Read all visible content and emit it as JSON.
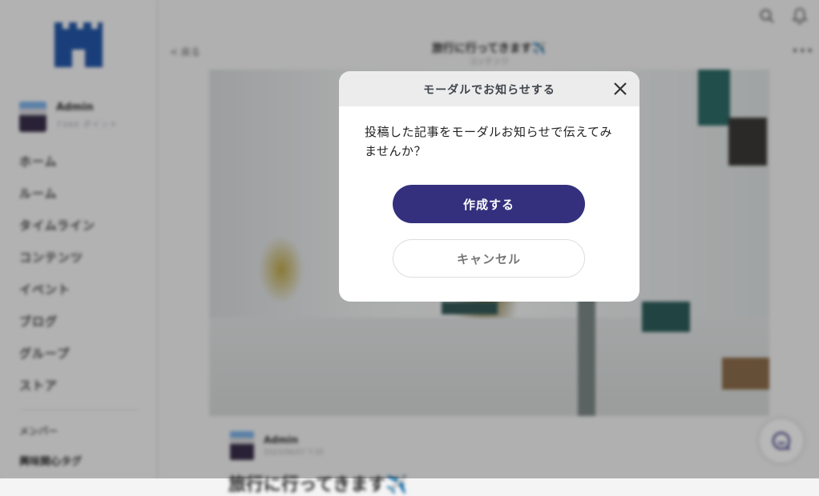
{
  "sidebar": {
    "profile": {
      "name": "Admin",
      "points": "7360 ポイント"
    },
    "nav": [
      "ホーム",
      "ルーム",
      "タイムライン",
      "コンテンツ",
      "イベント",
      "ブログ",
      "グループ",
      "ストア"
    ],
    "section_title": "メンバー",
    "tag_item": "興味関心タグ"
  },
  "header": {
    "back_label": "< 戻る",
    "title": "旅行に行ってきます✈️",
    "subtitle": "コンテンツ"
  },
  "post": {
    "author_name": "Admin",
    "date": "2023/06/07 7:35",
    "heading": "旅行に行ってきます✈️"
  },
  "modal": {
    "title": "モーダルでお知らせする",
    "message": "投稿した記事をモーダルお知らせで伝えてみませんか？",
    "create_label": "作成する",
    "cancel_label": "キャンセル"
  },
  "colors": {
    "primary": "#34307e",
    "logo": "#2457a8",
    "overlay": "rgba(0,0,0,0.28)"
  },
  "icons": [
    "castle-logo",
    "search-icon",
    "bell-icon",
    "more-icon",
    "close-icon",
    "chat-icon"
  ]
}
